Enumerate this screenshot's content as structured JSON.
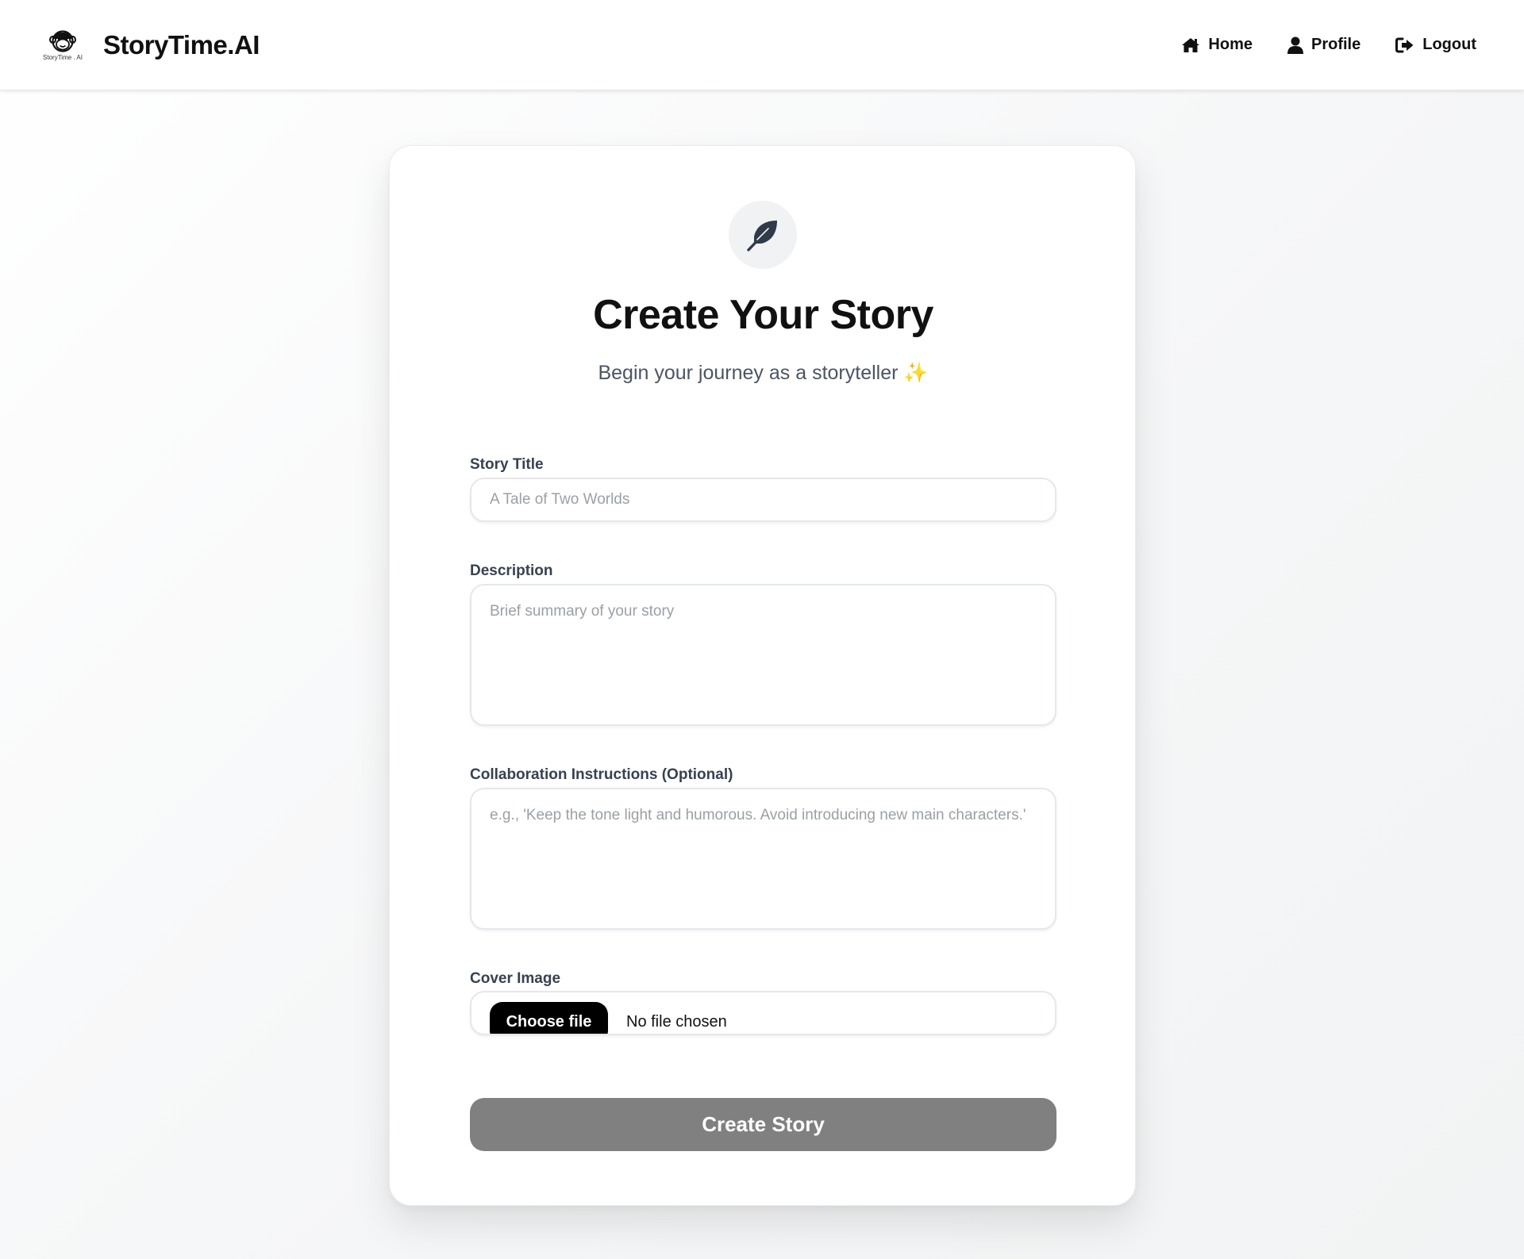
{
  "header": {
    "logo_caption": "StoryTime . AI",
    "brand": "StoryTime.AI",
    "nav": [
      {
        "label": "Home",
        "icon": "home-icon"
      },
      {
        "label": "Profile",
        "icon": "user-icon"
      },
      {
        "label": "Logout",
        "icon": "logout-icon"
      }
    ]
  },
  "form": {
    "icon": "feather-icon",
    "title": "Create Your Story",
    "subtitle": "Begin your journey as a storyteller ✨",
    "fields": {
      "story_title": {
        "label": "Story Title",
        "placeholder": "A Tale of Two Worlds",
        "value": ""
      },
      "description": {
        "label": "Description",
        "placeholder": "Brief summary of your story",
        "value": ""
      },
      "instructions": {
        "label": "Collaboration Instructions (Optional)",
        "placeholder": "e.g., 'Keep the tone light and humorous. Avoid introducing new main characters.'",
        "value": ""
      },
      "cover_image": {
        "label": "Cover Image",
        "button": "Choose file",
        "status": "No file chosen"
      }
    },
    "submit_label": "Create Story"
  },
  "colors": {
    "submit_bg": "#808080",
    "choose_bg": "#000000",
    "label": "#374151",
    "subtitle": "#4b5563",
    "placeholder": "#9aa0a6"
  }
}
